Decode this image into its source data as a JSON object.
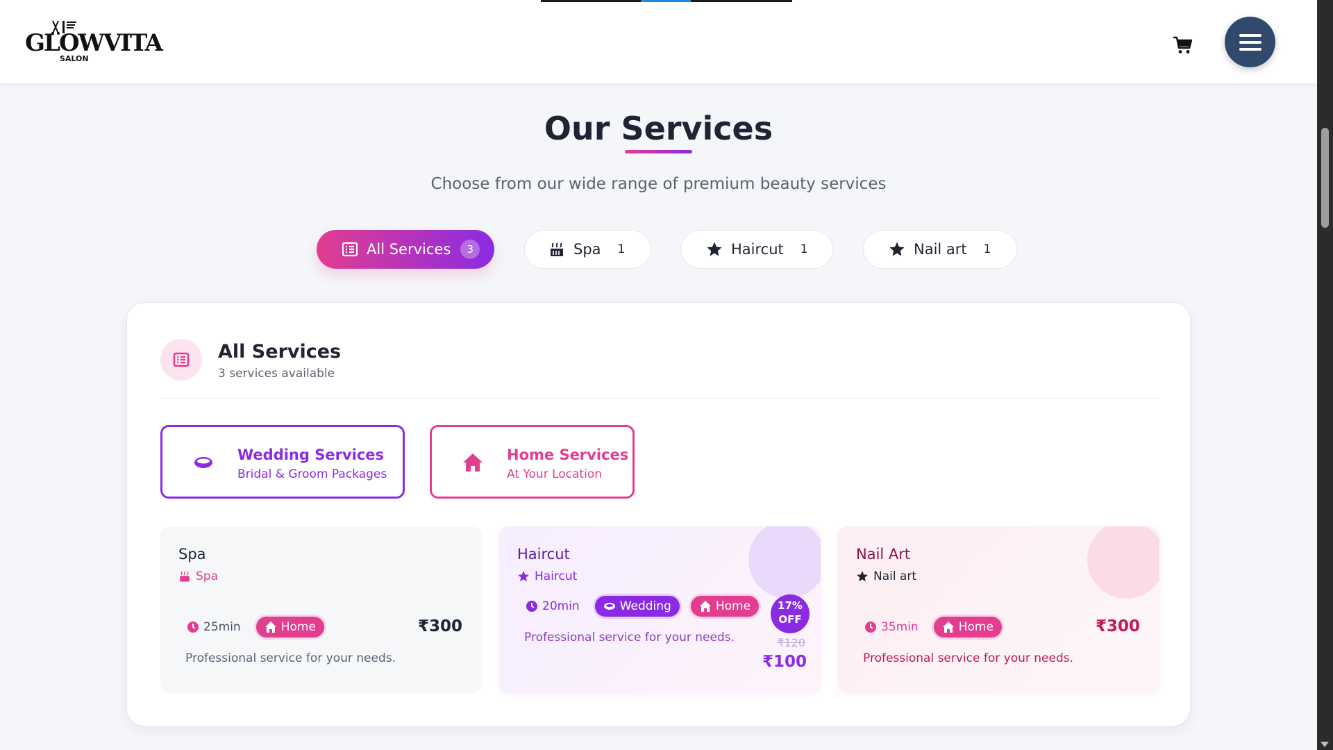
{
  "header": {
    "logo_text": "GLOWVITA",
    "logo_sub": "SALON",
    "cart_icon": "shopping-cart-icon",
    "menu_icon": "hamburger-menu-icon",
    "menu_color": "#2f4a6d"
  },
  "section": {
    "title": "Our Services",
    "subtitle": "Choose from our wide range of premium beauty services"
  },
  "tabs": [
    {
      "label": "All Services",
      "count": "3",
      "icon": "list-icon",
      "active": true
    },
    {
      "label": "Spa",
      "count": "1",
      "icon": "spa-icon",
      "active": false
    },
    {
      "label": "Haircut",
      "count": "1",
      "icon": "star-icon",
      "active": false
    },
    {
      "label": "Nail art",
      "count": "1",
      "icon": "star-icon",
      "active": false
    }
  ],
  "panel": {
    "title": "All Services",
    "subtitle": "3 services available",
    "features": [
      {
        "title": "Wedding Services",
        "subtitle": "Bridal & Groom Packages",
        "icon": "ring-icon"
      },
      {
        "title": "Home Services",
        "subtitle": "At Your Location",
        "icon": "home-icon"
      }
    ],
    "services": [
      {
        "name": "Spa",
        "category": "Spa",
        "duration": "25min",
        "tags": [
          "Home"
        ],
        "price": "₹300",
        "description": "Professional service for your needs."
      },
      {
        "name": "Haircut",
        "category": "Haircut",
        "duration": "20min",
        "tags": [
          "Wedding",
          "Home"
        ],
        "discount_line1": "17%",
        "discount_line2": "OFF",
        "original_price": "₹120",
        "price": "₹100",
        "description": "Professional service for your needs."
      },
      {
        "name": "Nail Art",
        "category": "Nail art",
        "duration": "35min",
        "tags": [
          "Home"
        ],
        "price": "₹300",
        "description": "Professional service for your needs."
      }
    ]
  },
  "colors": {
    "pink": "#e23d8f",
    "purple": "#8a2be2",
    "dark": "#1e2433"
  }
}
